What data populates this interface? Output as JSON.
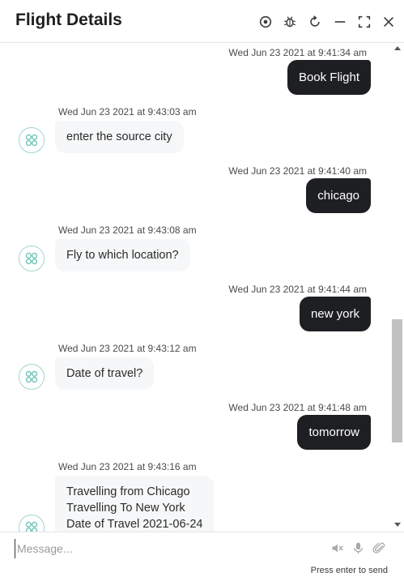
{
  "header": {
    "title": "Flight Details"
  },
  "messages": [
    {
      "sender": "user",
      "timestamp": "Wed Jun 23 2021 at 9:41:34 am",
      "text": "Book Flight"
    },
    {
      "sender": "bot",
      "timestamp": "Wed Jun 23 2021 at 9:43:03 am",
      "text": "enter the source city"
    },
    {
      "sender": "user",
      "timestamp": "Wed Jun 23 2021 at 9:41:40 am",
      "text": "chicago"
    },
    {
      "sender": "bot",
      "timestamp": "Wed Jun 23 2021 at 9:43:08 am",
      "text": "Fly to which location?"
    },
    {
      "sender": "user",
      "timestamp": "Wed Jun 23 2021 at 9:41:44 am",
      "text": "new york"
    },
    {
      "sender": "bot",
      "timestamp": "Wed Jun 23 2021 at 9:43:12 am",
      "text": "Date of travel?"
    },
    {
      "sender": "user",
      "timestamp": "Wed Jun 23 2021 at 9:41:48 am",
      "text": "tomorrow"
    },
    {
      "sender": "bot",
      "timestamp": "Wed Jun 23 2021 at 9:43:16 am",
      "lines": [
        "Travelling from Chicago",
        "Travelling To New York",
        "Date of Travel 2021-06-24"
      ]
    }
  ],
  "composer": {
    "placeholder": "Message...",
    "hint": "Press enter to send"
  },
  "colors": {
    "user_bubble": "#1e1f22",
    "bot_bubble": "#f6f7f8",
    "avatar_accent": "#5fbfb3"
  }
}
